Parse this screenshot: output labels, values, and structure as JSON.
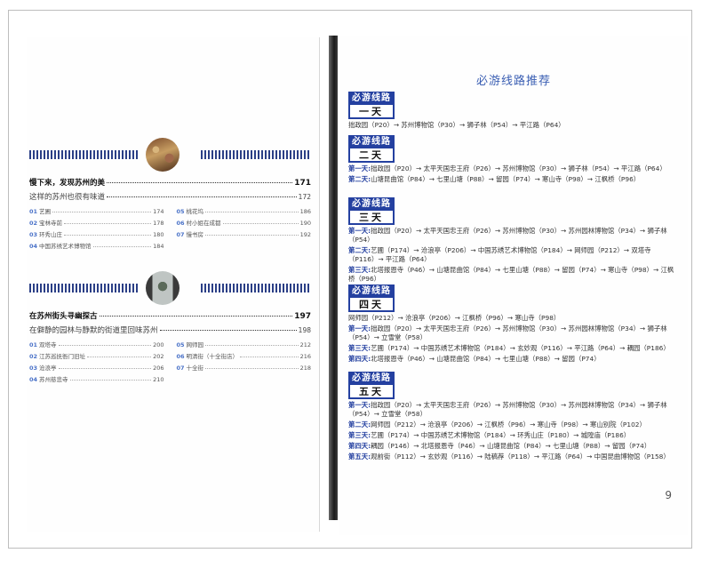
{
  "left_page": {
    "section1": {
      "title": "慢下来，发现苏州的美",
      "page": "171",
      "subtitle": "这样的苏州也很有味道",
      "subtitle_page": "172",
      "items": [
        {
          "num": "01",
          "label": "艺圃",
          "page": "174"
        },
        {
          "num": "05",
          "label": "桃花坞",
          "page": "186"
        },
        {
          "num": "02",
          "label": "宝林寺前",
          "page": "178"
        },
        {
          "num": "06",
          "label": "村小姐在成都",
          "page": "190"
        },
        {
          "num": "03",
          "label": "环秀山庄",
          "page": "180"
        },
        {
          "num": "07",
          "label": "慢书房",
          "page": "192"
        },
        {
          "num": "04",
          "label": "中国苏绣艺术博物馆",
          "page": "184"
        }
      ]
    },
    "section2": {
      "title": "在苏州街头寻幽探古",
      "page": "197",
      "subtitle": "在僻静的园林与静默的街道里回味苏州",
      "subtitle_page": "198",
      "items": [
        {
          "num": "01",
          "label": "双塔寺",
          "page": "200"
        },
        {
          "num": "05",
          "label": "网师园",
          "page": "212"
        },
        {
          "num": "02",
          "label": "江苏巡抚衙门旧址",
          "page": "202"
        },
        {
          "num": "06",
          "label": "明清街（十全街店）",
          "page": "216"
        },
        {
          "num": "03",
          "label": "沧浪亭",
          "page": "206"
        },
        {
          "num": "07",
          "label": "十全街",
          "page": "218"
        },
        {
          "num": "04",
          "label": "苏州慈悲寺",
          "page": "210"
        }
      ]
    }
  },
  "right_page": {
    "title": "必游线路推荐",
    "badge_top": "必游线路",
    "page_number": "9",
    "routes": [
      {
        "days": "一天",
        "lines": [
          {
            "label": "",
            "text": "拙政园（P20）→ 苏州博物馆（P30）→ 狮子林（P54）→ 平江路（P64）"
          }
        ]
      },
      {
        "days": "二天",
        "lines": [
          {
            "label": "第一天:",
            "text": "拙政园（P20）→ 太平天国忠王府（P26）→ 苏州博物馆（P30）→ 狮子林（P54）→ 平江路（P64）"
          },
          {
            "label": "第二天:",
            "text": "山塘昆曲馆（P84）→ 七里山塘（P88）→ 留园（P74）→ 寒山寺（P98）→ 江枫桥（P96）"
          }
        ]
      },
      {
        "days": "三天",
        "lines": [
          {
            "label": "第一天:",
            "text": "拙政园（P20）→ 太平天国忠王府（P26）→ 苏州博物馆（P30）→ 苏州园林博物馆（P34）→ 狮子林（P54）"
          },
          {
            "label": "第二天:",
            "text": "艺圃（P174）→ 沧浪亭（P206）→ 中国苏绣艺术博物馆（P184）→ 网师园（P212）→ 双塔寺（P116）→ 平江路（P64）"
          },
          {
            "label": "第三天:",
            "text": "北塔报恩寺（P46）→ 山塘昆曲馆（P84）→ 七里山塘（P88）→ 留园（P74）→ 寒山寺（P98）→ 江枫桥（P96）"
          }
        ]
      },
      {
        "days": "四天",
        "lines": [
          {
            "label": "",
            "text": "网师园（P212）→ 沧浪亭（P206）→ 江枫桥（P96）→ 寒山寺（P98）"
          },
          {
            "label": "第一天:",
            "text": "拙政园（P20）→ 太平天国忠王府（P26）→ 苏州博物馆（P30）→ 苏州园林博物馆（P34）→ 狮子林（P54）→ 立雪堂（P58）"
          },
          {
            "label": "第三天:",
            "text": "艺圃（P174）→ 中国苏绣艺术博物馆（P184）→ 玄妙观（P116）→ 平江路（P64）→ 耦园（P186）"
          },
          {
            "label": "第四天:",
            "text": "北塔报恩寺（P46）→ 山塘昆曲馆（P84）→ 七里山塘（P88）→ 留园（P74）"
          }
        ]
      },
      {
        "days": "五天",
        "lines": [
          {
            "label": "第一天:",
            "text": "拙政园（P20）→ 太平天国忠王府（P26）→ 苏州博物馆（P30）→ 苏州园林博物馆（P34）→ 狮子林（P54）→ 立雪堂（P58）"
          },
          {
            "label": "第二天:",
            "text": "网师园（P212）→ 沧浪亭（P206）→ 江枫桥（P96）→ 寒山寺（P98）→ 寒山别院（P102）"
          },
          {
            "label": "第三天:",
            "text": "艺圃（P174）→ 中国苏绣艺术博物馆（P184）→ 环秀山庄（P180）→ 城隍庙（P186）"
          },
          {
            "label": "第四天:",
            "text": "耦园（P146）→ 北塔报恩寺（P46）→ 山塘昆曲馆（P84）→ 七里山塘（P88）→ 留园（P74）"
          },
          {
            "label": "第五天:",
            "text": "观前街（P112）→ 玄妙观（P116）→ 陆稿荐（P118）→ 平江路（P64）→ 中国昆曲博物馆（P158）"
          }
        ]
      }
    ]
  }
}
